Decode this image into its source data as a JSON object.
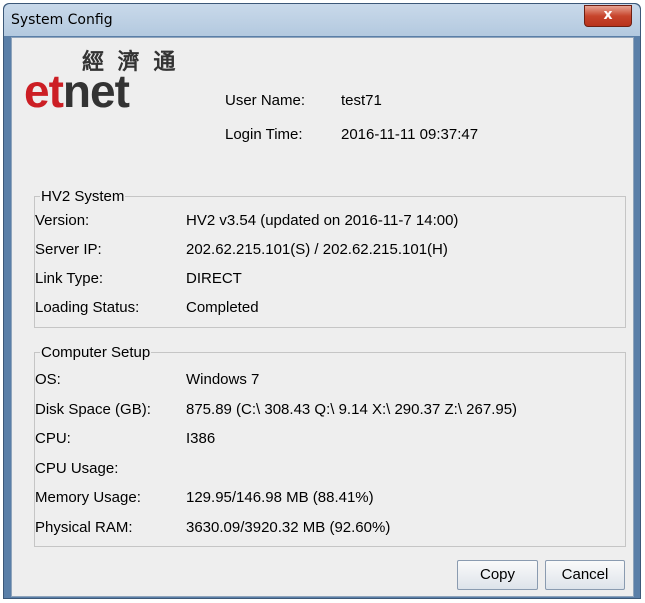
{
  "window": {
    "title": "System Config",
    "close_symbol": "x"
  },
  "logo": {
    "chinese": "經 濟 通",
    "et": "et",
    "net": "net"
  },
  "user": {
    "name_label": "User Name:",
    "name_value": "test71",
    "login_label": "Login Time:",
    "login_value": "2016-11-11 09:37:47"
  },
  "hv2": {
    "title": "HV2 System",
    "rows": [
      {
        "label": "Version:",
        "value": "HV2  v3.54  (updated on 2016-11-7 14:00)"
      },
      {
        "label": "Server IP:",
        "value": "202.62.215.101(S) / 202.62.215.101(H)"
      },
      {
        "label": "Link Type:",
        "value": "DIRECT"
      },
      {
        "label": "Loading Status:",
        "value": "Completed"
      }
    ]
  },
  "computer": {
    "title": "Computer Setup",
    "rows": [
      {
        "label": "OS:",
        "value": "Windows 7"
      },
      {
        "label": "Disk Space (GB):",
        "value": "875.89 (C:\\ 308.43  Q:\\ 9.14  X:\\ 290.37  Z:\\ 267.95)"
      },
      {
        "label": "CPU:",
        "value": "I386"
      },
      {
        "label": "CPU Usage:",
        "value": ""
      },
      {
        "label": "Memory Usage:",
        "value": "129.95/146.98 MB (88.41%)"
      },
      {
        "label": "Physical RAM:",
        "value": "3630.09/3920.32 MB (92.60%)"
      }
    ]
  },
  "buttons": {
    "copy": "Copy",
    "cancel": "Cancel"
  }
}
